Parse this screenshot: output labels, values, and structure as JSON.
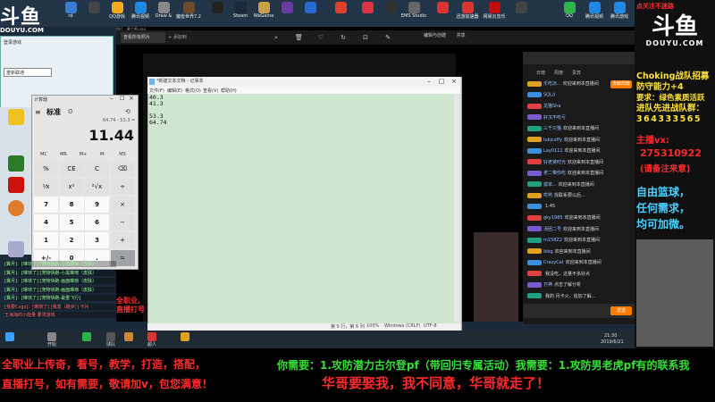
{
  "top_left_logo": {
    "cn": "斗鱼",
    "en": "DOUYU.COM"
  },
  "desktop_icons": [
    "",
    "",
    "rd",
    "",
    "QQ游戏",
    "腾讯视频",
    "Draw &",
    "魔兽世界7.2",
    "",
    "Steam",
    "WeGame",
    "",
    "",
    "",
    "",
    "",
    "",
    "",
    "EMS Studio",
    "",
    "迅游加速器",
    "网易云音乐",
    "",
    "",
    "",
    "",
    "QQ",
    "腾讯视频",
    "腾讯游戏"
  ],
  "left_app": {
    "title": "登录游戏",
    "input": "重新联通"
  },
  "calculator": {
    "title": "计算器",
    "mode": "标准",
    "mode_icon": "ʘ",
    "history_icon": "⟲",
    "expression": "64.74 - 53.3 =",
    "display": "11.44",
    "memory": [
      "MC",
      "MR",
      "M+",
      "M-",
      "MS"
    ],
    "keys": [
      [
        "%",
        "CE",
        "C",
        "⌫"
      ],
      [
        "⅟x",
        "x²",
        "²√x",
        "÷"
      ],
      [
        "7",
        "8",
        "9",
        "×"
      ],
      [
        "4",
        "5",
        "6",
        "−"
      ],
      [
        "1",
        "2",
        "3",
        "+"
      ],
      [
        "+/-",
        "0",
        ".",
        "="
      ]
    ]
  },
  "viewer": {
    "tab": "查看所有照片",
    "tab2": "+ 添加到",
    "edit_label": "编辑与创建",
    "share_label": "共享",
    "title": "照片 - 截个图.png"
  },
  "notepad": {
    "title": "*新建文本文档 - 记事本",
    "menu": [
      "文件(F)",
      "编辑(E)",
      "格式(O)",
      "查看(V)",
      "帮助(H)"
    ],
    "lines": [
      "40.3",
      "41.3",
      "",
      "53.3",
      "64.74"
    ],
    "status": [
      "第 5 行，第 6 列",
      "100%",
      "Windows (CRLF)",
      "UTF-8"
    ]
  },
  "chat": {
    "rank_label": "贡献周榜",
    "tabs": [
      "日榜",
      "周榜",
      "贵宾"
    ],
    "messages": [
      {
        "name": "乐吃凉...",
        "text": "欢迎来到本直播间"
      },
      {
        "name": "SQLd",
        "text": ""
      },
      {
        "name": "龙猫Sha",
        "text": ""
      },
      {
        "name": "好汉不吃亏",
        "text": ""
      },
      {
        "name": "三千只猫",
        "text": "欢迎来到本直播间"
      },
      {
        "name": "lukjcxffy",
        "text": "欢迎来到本直播间"
      },
      {
        "name": "Lay0111",
        "text": "欢迎来到本直播间"
      },
      {
        "name": "好老婆时光",
        "text": "欢迎来到本直播间"
      },
      {
        "name": "老二带你吃",
        "text": "欢迎来到本直播间"
      },
      {
        "name": "孤单...",
        "text": "欢迎来到本直播间"
      },
      {
        "name": "哎哟",
        "text": "找联系要以后..."
      },
      {
        "name": "",
        "text": "1:45"
      },
      {
        "name": "gky1985",
        "text": "欢迎来到本直播间"
      },
      {
        "name": "汤团二号",
        "text": "欢迎来到本直播间"
      },
      {
        "name": "m158Z2",
        "text": "欢迎来到本直播间"
      },
      {
        "name": "ikbg",
        "text": "欢迎来到本直播间"
      },
      {
        "name": "CrazyCat",
        "text": "欢迎来到本直播间"
      },
      {
        "name": "",
        "text": "我没吃，这量不多好点"
      },
      {
        "name": "万神",
        "text": "点击了解分析"
      },
      {
        "name": "",
        "text": "我的 月卡火，追加了解..."
      }
    ],
    "input_placeholder": "",
    "send_label": "发送"
  },
  "left_chat": [
    "[翼月]：[琳琐了] [宠物快跑-小黑琳琐（皮肤）",
    "[翼月]：[琳琐了] [宠物快跑-小黑琳琐（皮肤）",
    "[翼月]：[琳琐了] [宠物快跑-画面琳琐（皮肤）",
    "[翼月]：[琳琐了] [宠物快跑-画面琳琐（皮肤）",
    "[翼月]：[琳琐了] [宠物快跑-最重飞行]",
    "[我要Cxgs]：[琳琐了] [我发（跑步）] 卡片",
    "王海海的小能量 要求游戏"
  ],
  "left_promo": [
    "全职业,",
    "直播打号"
  ],
  "taskbar": {
    "items": [
      "开始",
      "",
      "搜索",
      "",
      "",
      "球队",
      "超人",
      "",
      "网易云"
    ],
    "tray_time": "21:30",
    "tray_date": "2019/6/21"
  },
  "right_panel": {
    "top": "点关注不迷路",
    "logo_cn": "斗鱼",
    "logo_en": "DOUYU.COM",
    "recruit": [
      "Choking战队招募",
      "防守能力+4",
      "要求：绿色素质活跃",
      "进队先进战队群：",
      "364333565"
    ],
    "vx_label": "主播vx:",
    "vx": "275310922",
    "vx_note": "(请备注来意)",
    "freedom": [
      "自由篮球，",
      "任何需求，",
      "均可加微。"
    ],
    "colors": {
      "yellow": "#ffe23a",
      "red": "#ff2a2a",
      "white": "#ffffff",
      "cyan": "#49d1ff"
    }
  },
  "banner": {
    "line1_red": "全职业上传奇，看号，教学，打造，搭配，",
    "line1_green": "你需要：1.攻防潜力古尔登pf（带回归专属活动）我需要：1.攻防男老虎pf有的联系我",
    "line2": "直播打号，如有需要，敬请加v，包您满意！",
    "line3": "华哥要娶我，我不同意，华哥就走了！"
  }
}
